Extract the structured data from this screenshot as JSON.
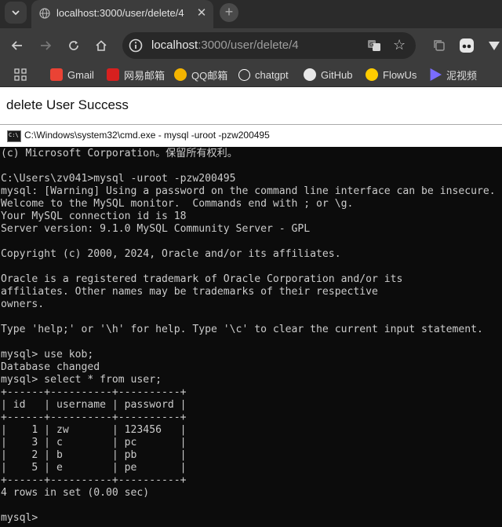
{
  "browser": {
    "tab_title": "localhost:3000/user/delete/4",
    "url_host": "localhost",
    "url_rest": ":3000/user/delete/4",
    "bookmarks": [
      {
        "label": "Gmail",
        "icon": "gmail-icon",
        "color": "#ea4335"
      },
      {
        "label": "网易邮箱",
        "icon": "netease-mail-icon",
        "color": "#d7201f"
      },
      {
        "label": "QQ邮箱",
        "icon": "qq-mail-icon",
        "color": "#f4b400"
      },
      {
        "label": "chatgpt",
        "icon": "chatgpt-icon",
        "color": "#ffffff"
      },
      {
        "label": "GitHub",
        "icon": "github-icon",
        "color": "#ffffff"
      },
      {
        "label": "FlowUs",
        "icon": "flowus-icon",
        "color": "#ffcc00"
      },
      {
        "label": "泥视频",
        "icon": "video-icon",
        "color": "#7a6cff"
      }
    ]
  },
  "page": {
    "message": "delete User Success"
  },
  "cmd": {
    "title": "C:\\Windows\\system32\\cmd.exe - mysql  -uroot -pzw200495",
    "lines": [
      "(c) Microsoft Corporation。保留所有权利。",
      "",
      "C:\\Users\\zv041>mysql -uroot -pzw200495",
      "mysql: [Warning] Using a password on the command line interface can be insecure.",
      "Welcome to the MySQL monitor.  Commands end with ; or \\g.",
      "Your MySQL connection id is 18",
      "Server version: 9.1.0 MySQL Community Server - GPL",
      "",
      "Copyright (c) 2000, 2024, Oracle and/or its affiliates.",
      "",
      "Oracle is a registered trademark of Oracle Corporation and/or its",
      "affiliates. Other names may be trademarks of their respective",
      "owners.",
      "",
      "Type 'help;' or '\\h' for help. Type '\\c' to clear the current input statement.",
      "",
      "mysql> use kob;",
      "Database changed",
      "mysql> select * from user;",
      "+------+----------+----------+",
      "| id   | username | password |",
      "+------+----------+----------+",
      "|    1 | zw       | 123456   |",
      "|    3 | c        | pc       |",
      "|    2 | b        | pb       |",
      "|    5 | e        | pe       |",
      "+------+----------+----------+",
      "4 rows in set (0.00 sec)",
      "",
      "mysql>"
    ]
  }
}
